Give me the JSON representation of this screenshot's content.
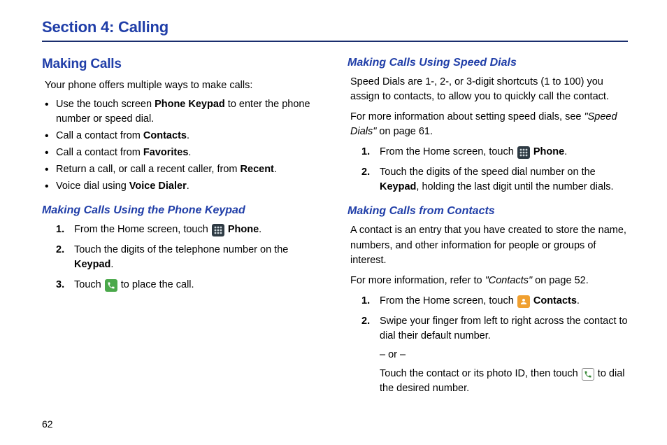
{
  "page_number": "62",
  "section_title": "Section 4: Calling",
  "left": {
    "h2": "Making Calls",
    "intro": "Your phone offers multiple ways to make calls:",
    "bullets": [
      {
        "pre": "Use the touch screen ",
        "bold": "Phone Keypad",
        "post": " to enter the phone number or speed dial."
      },
      {
        "pre": "Call a contact from ",
        "bold": "Contacts",
        "post": "."
      },
      {
        "pre": "Call a contact from ",
        "bold": "Favorites",
        "post": "."
      },
      {
        "pre": "Return a call, or call a recent caller, from ",
        "bold": "Recent",
        "post": "."
      },
      {
        "pre": "Voice dial using ",
        "bold": "Voice Dialer",
        "post": "."
      }
    ],
    "h3": "Making Calls Using the Phone Keypad",
    "steps": {
      "s1_pre": "From the Home screen, touch ",
      "s1_bold": "Phone",
      "s1_post": ".",
      "s2_pre": "Touch the digits of the telephone number on the ",
      "s2_bold": "Keypad",
      "s2_post": ".",
      "s3_pre": "Touch ",
      "s3_post": " to place the call."
    }
  },
  "right": {
    "h3a": "Making Calls Using Speed Dials",
    "p1": "Speed Dials are 1-, 2-, or 3-digit shortcuts (1 to 100) you assign to contacts, to allow you to quickly call the contact.",
    "p2_pre": "For more information about setting speed dials, see ",
    "p2_italic": "\"Speed Dials\"",
    "p2_post": " on page 61.",
    "stepsA": {
      "s1_pre": "From the Home screen, touch ",
      "s1_bold": "Phone",
      "s1_post": ".",
      "s2_pre": "Touch the digits of the speed dial number on the ",
      "s2_bold": "Keypad",
      "s2_post": ", holding the last digit until the number dials."
    },
    "h3b": "Making Calls from Contacts",
    "p3": "A contact is an entry that you have created to store the name, numbers, and other information for people or groups of interest.",
    "p4_pre": "For more information, refer to ",
    "p4_italic": "\"Contacts\"",
    "p4_post": " on page 52.",
    "stepsB": {
      "s1_pre": "From the Home screen, touch ",
      "s1_bold": "Contacts",
      "s1_post": ".",
      "s2": "Swipe your finger from left to right across the contact to dial their default number.",
      "or": "– or –",
      "s2b_pre": "Touch the contact or its photo ID, then touch ",
      "s2b_post": " to dial the desired number."
    }
  }
}
